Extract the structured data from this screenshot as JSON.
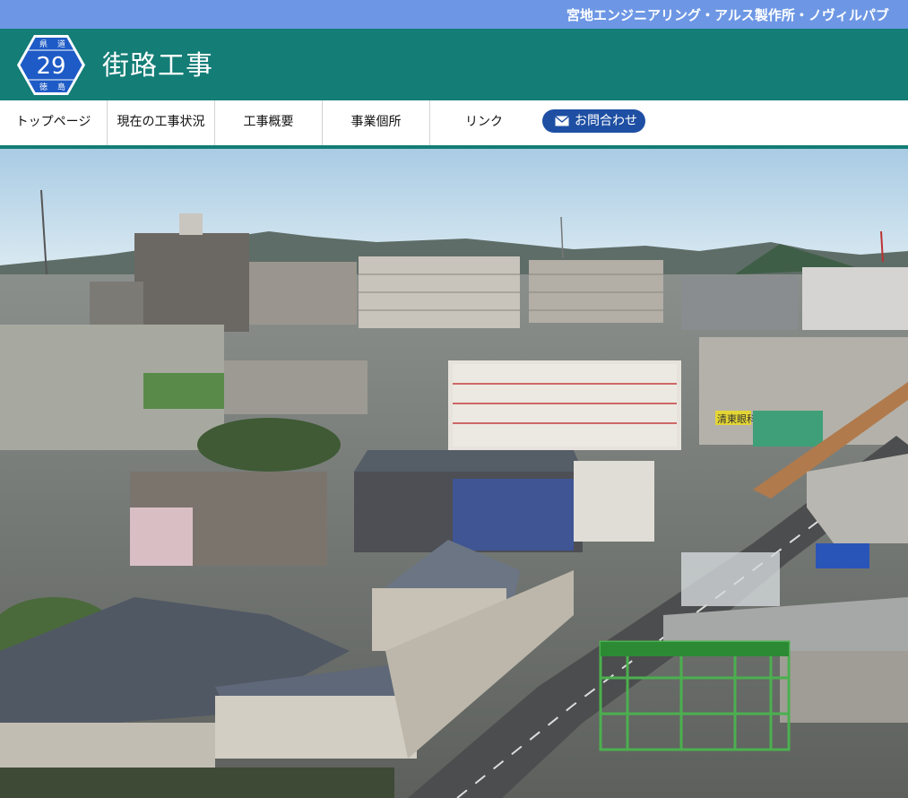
{
  "ticker": {
    "text": "宮地エンジニアリング・アルス製作所・ノヴィルパブ"
  },
  "header": {
    "title": "街路工事",
    "sign": {
      "pref_left": "県",
      "pref_right": "道",
      "number": "29",
      "bottom_left": "徳",
      "bottom_right": "島"
    }
  },
  "nav": {
    "items": [
      {
        "label": "トップページ"
      },
      {
        "label": "現在の工事状況"
      },
      {
        "label": "工事概要"
      },
      {
        "label": "事業個所"
      },
      {
        "label": "リンク"
      }
    ],
    "contact_label": "お問合わせ",
    "contact_icon": "mail-icon"
  },
  "colors": {
    "ticker_bg": "#6d97e4",
    "header_bg": "#137d76",
    "contact_bg": "#1e4fa3",
    "sign_blue": "#1e5bc6"
  },
  "hero": {
    "sign_text": "清東眼科"
  }
}
